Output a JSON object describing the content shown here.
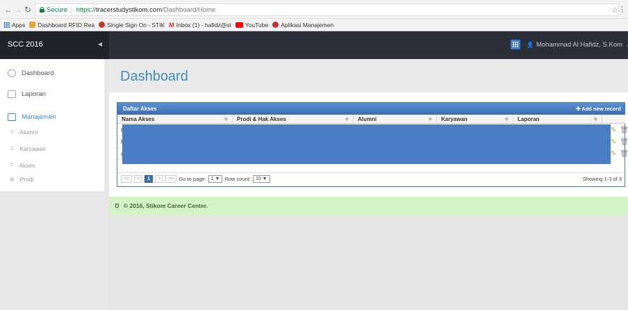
{
  "browser": {
    "secure_label": "Secure",
    "url_scheme": "https://",
    "url_host": "tracerstudystikom.com",
    "url_path": "/Dashboard/Home",
    "bookmarks": [
      {
        "label": "Apps",
        "color": "#1a73e8"
      },
      {
        "label": "Dashboard RFID Rea",
        "color": "#e8a33b"
      },
      {
        "label": "Single Sign On - STIK",
        "color": "#c0392b"
      },
      {
        "label": "Inbox (1) - hafidz@st",
        "color": "#d93025"
      },
      {
        "label": "YouTube",
        "color": "#ff0000"
      },
      {
        "label": "Aplikasi Manajemen",
        "color": "#c0392b"
      }
    ]
  },
  "header": {
    "brand": "SCC 2016",
    "user_name": "Mohammad Al Hafidz, S.Kom"
  },
  "sidebar": {
    "items": [
      {
        "label": "Dashboard",
        "icon": "dashboard-icon"
      },
      {
        "label": "Laporan",
        "icon": "report-icon"
      },
      {
        "label": "Manajemen",
        "icon": "table-icon"
      }
    ],
    "sub_items": [
      {
        "label": "Alumni"
      },
      {
        "label": "Karyawan"
      },
      {
        "label": "Akses"
      },
      {
        "label": "Prodi"
      }
    ]
  },
  "main": {
    "page_title": "Dashboard",
    "panel_title": "Daftar Akses",
    "add_record": "Add new record",
    "columns": [
      "Nama Akses",
      "Prodi & Hak Akses",
      "Alumni",
      "Karyawan",
      "Laporan"
    ],
    "row_initials": [
      "K",
      "P",
      "a"
    ],
    "pager": {
      "first": "<<",
      "prev": "<",
      "current": "1",
      "next": ">",
      "last": ">>",
      "goto_label": "Go to page:",
      "goto_value": "1 ▼",
      "rowcount_label": "Row count:",
      "rowcount_value": "10 ▼",
      "showing": "Showing 1-3 of 3"
    }
  },
  "footer": {
    "text": "© 2016, Stikom Career Center."
  },
  "colors": {
    "accent": "#3c8dbc",
    "header_bg": "#2b2f3a",
    "panel_blue": "#4a7ec4",
    "footer_bg": "#d4f3c6"
  }
}
